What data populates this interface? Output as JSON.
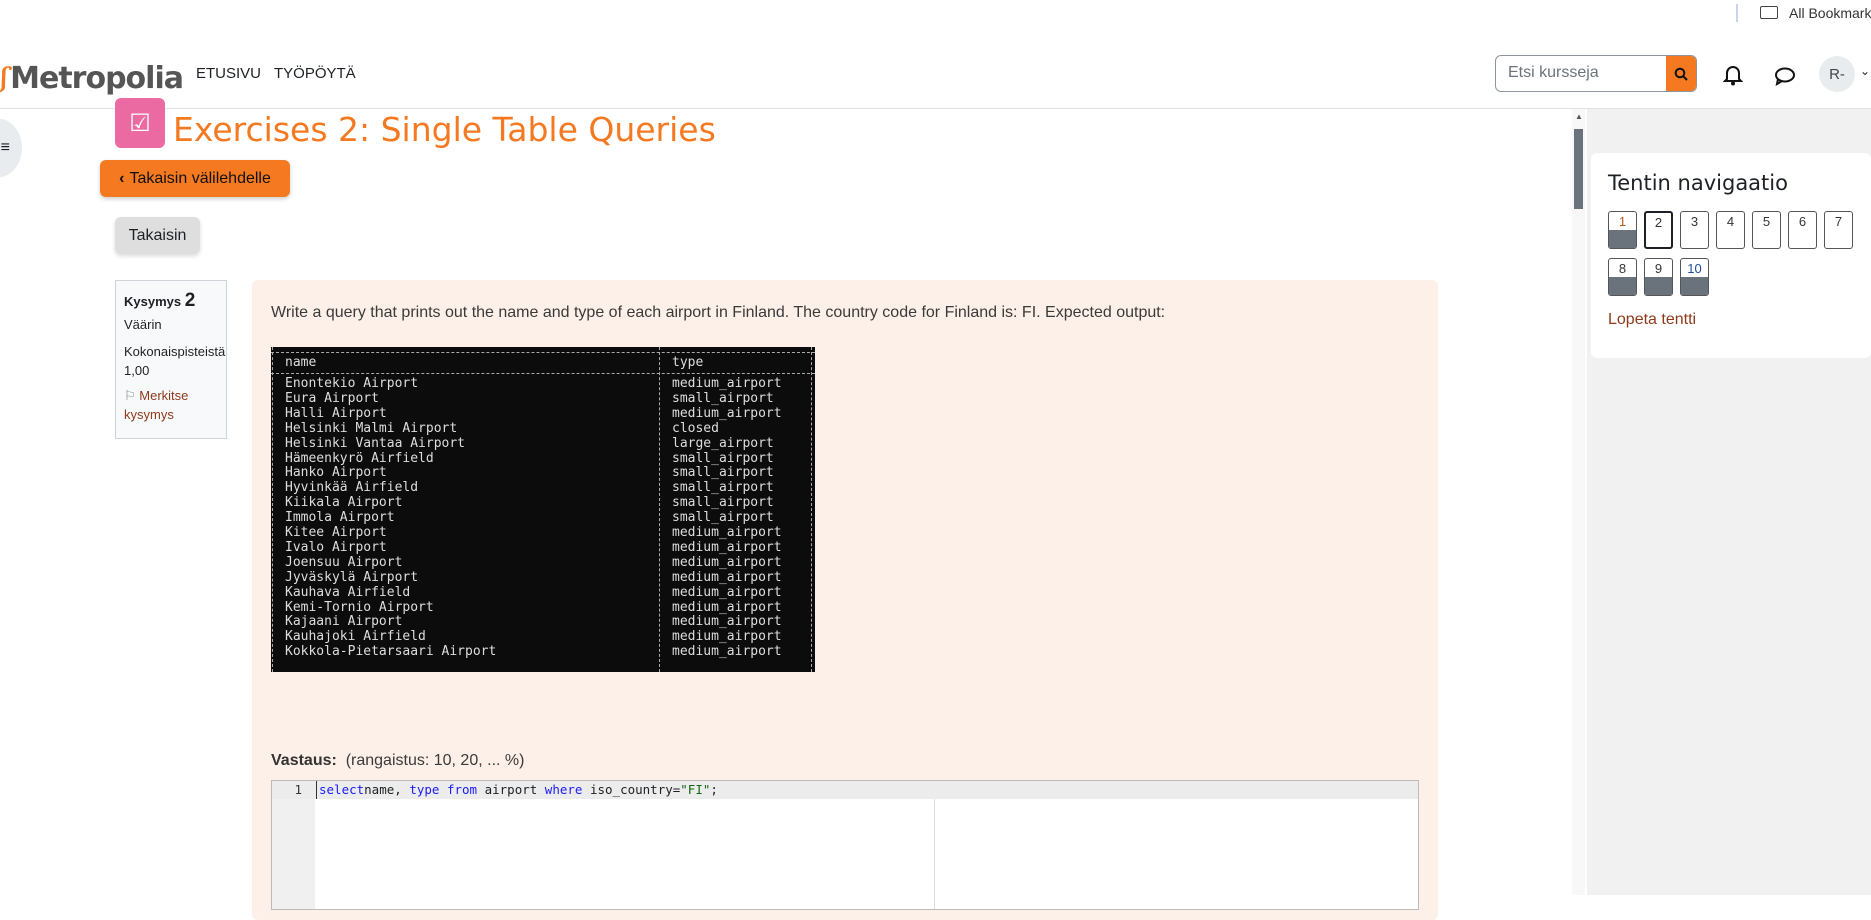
{
  "browser": {
    "bookmarks_label": "All Bookmarks"
  },
  "navbar": {
    "brand": "Metropolia",
    "links": [
      "ETUSIVU",
      "TYÖPÖYTÄ"
    ],
    "search_placeholder": "Etsi kursseja",
    "avatar_initials": "R-"
  },
  "page": {
    "title": "Exercises 2: Single Table Queries",
    "back_tab_label": "Takaisin välilehdelle",
    "back_label": "Takaisin"
  },
  "question_info": {
    "label": "Kysymys",
    "number": "2",
    "status": "Väärin",
    "points_label": "Kokonaispisteistä",
    "points": "1,00",
    "flag_label": "Merkitse kysymys"
  },
  "question": {
    "text": "Write a query that prints out the name and type of each airport in Finland. The country code for Finland is: FI. Expected output:",
    "table": {
      "headers": [
        "name",
        "type"
      ],
      "rows": [
        [
          "Enontekio Airport",
          "medium_airport"
        ],
        [
          "Eura Airport",
          "small_airport"
        ],
        [
          "Halli Airport",
          "medium_airport"
        ],
        [
          "Helsinki Malmi Airport",
          "closed"
        ],
        [
          "Helsinki Vantaa Airport",
          "large_airport"
        ],
        [
          "Hämeenkyrö Airfield",
          "small_airport"
        ],
        [
          "Hanko Airport",
          "small_airport"
        ],
        [
          "Hyvinkää Airfield",
          "small_airport"
        ],
        [
          "Kiikala Airport",
          "small_airport"
        ],
        [
          "Immola Airport",
          "small_airport"
        ],
        [
          "Kitee Airport",
          "medium_airport"
        ],
        [
          "Ivalo Airport",
          "medium_airport"
        ],
        [
          "Joensuu Airport",
          "medium_airport"
        ],
        [
          "Jyväskylä Airport",
          "medium_airport"
        ],
        [
          "Kauhava Airfield",
          "medium_airport"
        ],
        [
          "Kemi-Tornio Airport",
          "medium_airport"
        ],
        [
          "Kajaani Airport",
          "medium_airport"
        ],
        [
          "Kauhajoki Airfield",
          "medium_airport"
        ],
        [
          "Kokkola-Pietarsaari Airport",
          "medium_airport"
        ]
      ]
    },
    "answer_label": "Vastaus:",
    "answer_penalty": "(rangaistus: 10, 20, ... %)",
    "code": {
      "line_number": "1",
      "tokens": [
        [
          "kw",
          "select"
        ],
        [
          "",
          "name, "
        ],
        [
          "kw",
          "type"
        ],
        [
          "",
          " "
        ],
        [
          "kw",
          "from"
        ],
        [
          "",
          " airport "
        ],
        [
          "kw",
          "where"
        ],
        [
          "",
          " iso_country="
        ],
        [
          "str",
          "\"FI\""
        ],
        [
          "",
          ";"
        ]
      ]
    }
  },
  "quiz_nav": {
    "title": "Tentin navigaatio",
    "buttons": [
      {
        "label": "1",
        "state": "answered"
      },
      {
        "label": "2",
        "state": "current"
      },
      {
        "label": "3",
        "state": "unanswered"
      },
      {
        "label": "4",
        "state": "unanswered"
      },
      {
        "label": "5",
        "state": "unanswered"
      },
      {
        "label": "6",
        "state": "unanswered"
      },
      {
        "label": "7",
        "state": "unanswered"
      },
      {
        "label": "8",
        "state": "answered"
      },
      {
        "label": "9",
        "state": "answered"
      },
      {
        "label": "10",
        "state": "answered"
      }
    ],
    "finish_label": "Lopeta tentti"
  },
  "colors": {
    "brand_orange": "#f47920",
    "module_icon_pink": "#ea6aa1",
    "question_bg": "#fdf0e8",
    "link_red": "#8e3a1b"
  }
}
